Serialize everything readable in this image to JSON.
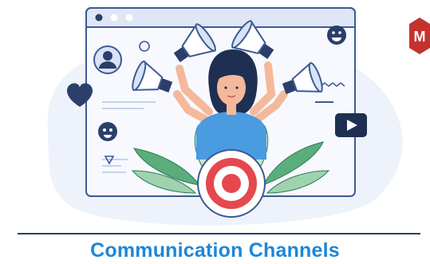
{
  "caption": "Communication Channels",
  "logo_letter": "M",
  "colors": {
    "caption": "#1f86d6",
    "navy": "#2b3f6b",
    "window_border": "#3b5a94",
    "window_header": "#dfe6f5",
    "blob": "#eef2fa",
    "skin": "#f4b99a",
    "shirt": "#4a9be0",
    "target_red": "#e5484d",
    "leaves": "#5aae7c",
    "logo": "#c4322e"
  },
  "icons": [
    "browser-window-icon",
    "megaphone-icon",
    "user-avatar-icon",
    "heart-icon",
    "smiley-icon",
    "video-play-icon",
    "target-icon",
    "leaf-icon",
    "brand-logo-icon"
  ]
}
